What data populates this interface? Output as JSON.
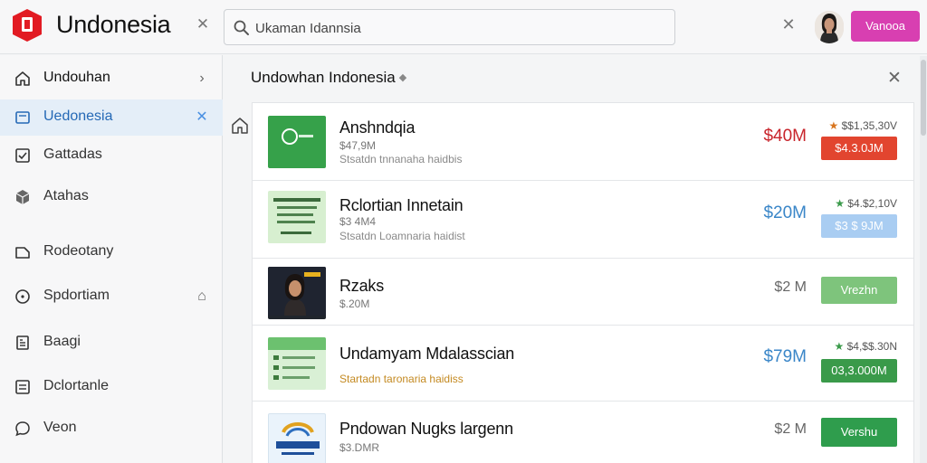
{
  "app": {
    "title": "Undonesia",
    "brand_color": "#e21b23",
    "accent_color": "#d83fb1"
  },
  "search": {
    "value": "Ukaman Idannsia",
    "placeholder": "Ukaman Idannsia"
  },
  "header": {
    "cta_label": "Vanooa"
  },
  "sidebar": {
    "items": [
      {
        "label": "Undouhan",
        "icon": "home-icon",
        "side": "›"
      },
      {
        "label": "Uedonesia",
        "icon": "card-icon",
        "side": "✕"
      },
      {
        "label": "Gattadas",
        "icon": "check-box-icon"
      },
      {
        "label": "Atahas",
        "icon": "cube-icon"
      },
      {
        "label": "Rodeotany",
        "icon": "bookmark-icon"
      },
      {
        "label": "Spdortiam",
        "icon": "clock-icon",
        "side": "⌂"
      },
      {
        "label": "Baagi",
        "icon": "document-icon"
      },
      {
        "label": "Dclortanle",
        "icon": "list-icon"
      },
      {
        "label": "Veon",
        "icon": "chat-icon"
      }
    ]
  },
  "main": {
    "title": "Undowhan Indonesia"
  },
  "rows": [
    {
      "name": "Anshndqia",
      "sub": "$47,9M",
      "desc": "Stsatdn tnnanaha haidbis",
      "value": "$40M",
      "value_color": "#c8242b",
      "delta": "$$1,35,30V",
      "pill": "$4.3.0JM",
      "pill_bg": "#e2452f",
      "pill_color": "#ffffff"
    },
    {
      "name": "Rclortian Innetain",
      "sub": "$3 4M4",
      "desc": "Stsatdn Loamnaria haidist",
      "value": "$20M",
      "value_color": "#3a86c8",
      "delta": "$4.$2,10V",
      "pill": "$3 $ 9JM",
      "pill_bg": "#a9cdf2",
      "pill_color": "#ffffff"
    },
    {
      "name": "Rzaks",
      "sub": "$.20M",
      "desc": "",
      "value": "$2 M",
      "value_color": "#666666",
      "delta": "",
      "pill": "Vrezhn",
      "pill_bg": "#7ec47c",
      "pill_color": "#ffffff"
    },
    {
      "name": "Undamyam Mdalasscian",
      "sub": "",
      "desc": "Startadn taronaria haidiss",
      "value": "$79M",
      "value_color": "#3a86c8",
      "delta": "$4,$$.30N",
      "pill": "03,3.000M",
      "pill_bg": "#3a9a4a",
      "pill_color": "#ffffff"
    },
    {
      "name": "Pndowan Nugks largenn",
      "sub": "$3.DMR",
      "desc": "",
      "value": "$2 M",
      "value_color": "#666666",
      "delta": "",
      "pill": "Vershu",
      "pill_bg": "#2f9d4d",
      "pill_color": "#ffffff"
    }
  ]
}
